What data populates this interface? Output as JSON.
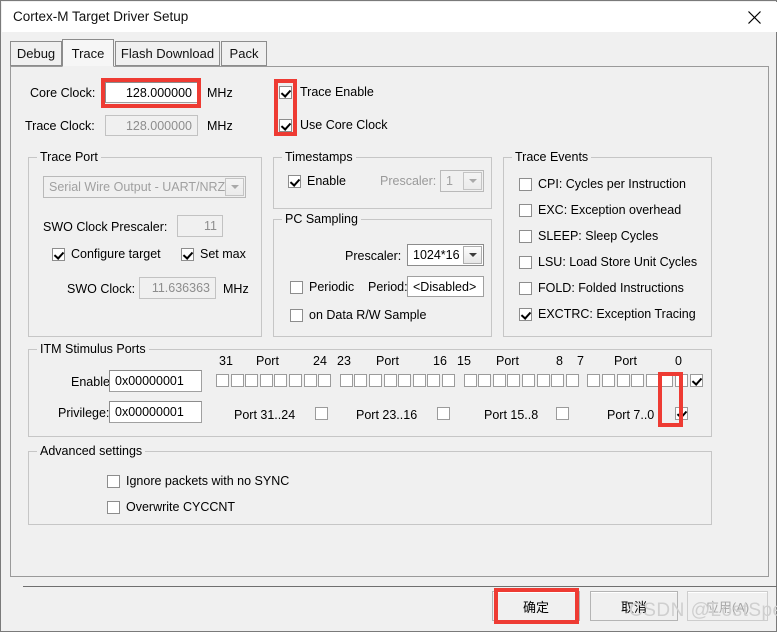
{
  "window": {
    "title": "Cortex-M Target Driver Setup",
    "close_icon": "close-icon"
  },
  "tabs": [
    {
      "label": "Debug",
      "active": false
    },
    {
      "label": "Trace",
      "active": true
    },
    {
      "label": "Flash Download",
      "active": false
    },
    {
      "label": "Pack",
      "active": false
    }
  ],
  "clocks": {
    "core_clock_label": "Core Clock:",
    "core_clock_value": "128.000000",
    "core_clock_unit": "MHz",
    "trace_clock_label": "Trace Clock:",
    "trace_clock_value": "128.000000",
    "trace_clock_unit": "MHz",
    "trace_enable_label": "Trace Enable",
    "trace_enable_checked": true,
    "use_core_clock_label": "Use Core Clock",
    "use_core_clock_checked": true
  },
  "trace_port": {
    "title": "Trace Port",
    "protocol_value": "Serial Wire Output - UART/NRZ",
    "prescaler_label": "SWO Clock Prescaler:",
    "prescaler_value": "11",
    "configure_target_label": "Configure target",
    "configure_target_checked": true,
    "set_max_label": "Set max",
    "set_max_checked": true,
    "swo_clock_label": "SWO Clock:",
    "swo_clock_value": "11.636363",
    "swo_clock_unit": "MHz"
  },
  "timestamps": {
    "title": "Timestamps",
    "enable_label": "Enable",
    "enable_checked": true,
    "prescaler_label": "Prescaler:",
    "prescaler_value": "1"
  },
  "pc_sampling": {
    "title": "PC Sampling",
    "prescaler_label": "Prescaler:",
    "prescaler_value": "1024*16",
    "periodic_label": "Periodic",
    "periodic_checked": false,
    "period_label": "Period:",
    "period_value": "<Disabled>",
    "data_rw_label": "on Data R/W Sample",
    "data_rw_checked": false
  },
  "trace_events": {
    "title": "Trace Events",
    "items": [
      {
        "label": "CPI: Cycles per Instruction",
        "checked": false
      },
      {
        "label": "EXC: Exception overhead",
        "checked": false
      },
      {
        "label": "SLEEP: Sleep Cycles",
        "checked": false
      },
      {
        "label": "LSU: Load Store Unit Cycles",
        "checked": false
      },
      {
        "label": "FOLD: Folded Instructions",
        "checked": false
      },
      {
        "label": "EXCTRC: Exception Tracing",
        "checked": true
      }
    ]
  },
  "itm": {
    "title": "ITM Stimulus Ports",
    "enable_label": "Enable:",
    "enable_value": "0x00000001",
    "privilege_label": "Privilege:",
    "privilege_value": "0x00000001",
    "scale_labels": [
      "31",
      "Port",
      "24",
      "23",
      "Port",
      "16",
      "15",
      "Port",
      "8",
      "7",
      "Port",
      "0"
    ],
    "group_rows": [
      {
        "label": "Port 31..24",
        "checked": false
      },
      {
        "label": "Port 23..16",
        "checked": false
      },
      {
        "label": "Port 15..8",
        "checked": false
      },
      {
        "label": "Port 7..0",
        "checked": true
      }
    ],
    "port_bits_checked": [
      false,
      false,
      false,
      false,
      false,
      false,
      false,
      false,
      false,
      false,
      false,
      false,
      false,
      false,
      false,
      false,
      false,
      false,
      false,
      false,
      false,
      false,
      false,
      false,
      false,
      false,
      false,
      false,
      false,
      false,
      false,
      true
    ]
  },
  "advanced": {
    "title": "Advanced settings",
    "ignore_sync_label": "Ignore packets with no SYNC",
    "ignore_sync_checked": false,
    "overwrite_cyccnt_label": "Overwrite CYCCNT",
    "overwrite_cyccnt_checked": false
  },
  "footer": {
    "ok_label": "确定",
    "cancel_label": "取消",
    "apply_label": "应用(A)",
    "apply_disabled": true
  },
  "watermark": {
    "text": "CSDN  @LostSpeed"
  },
  "colors": {
    "highlight": "#ee3b33",
    "dialog_bg": "#f0f0f0",
    "field_bg": "#ffffff"
  }
}
